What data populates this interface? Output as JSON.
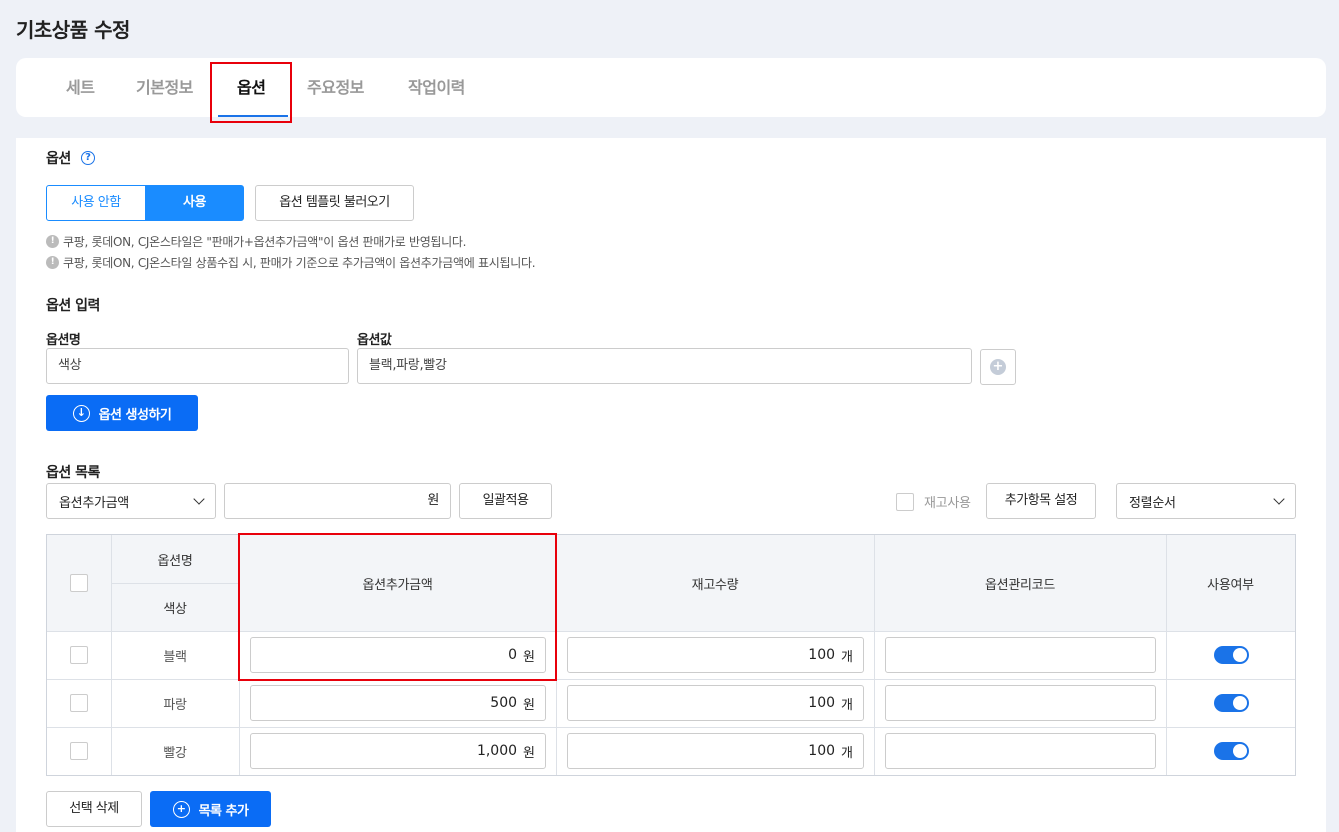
{
  "page_title": "기초상품 수정",
  "tabs": [
    {
      "label": "세트"
    },
    {
      "label": "기본정보"
    },
    {
      "label": "옵션",
      "active": true
    },
    {
      "label": "주요정보"
    },
    {
      "label": "작업이력"
    }
  ],
  "option": {
    "section_label": "옵션",
    "help_icon": "?",
    "toggle_off_label": "사용 안함",
    "toggle_on_label": "사용",
    "selected": "사용",
    "template_button": "옵션 템플릿 불러오기",
    "notices": [
      "쿠팡, 롯데ON, CJ온스타일은 \"판매가+옵션추가금액\"이 옵션 판매가로 반영됩니다.",
      "쿠팡, 롯데ON, CJ온스타일 상품수집 시, 판매가 기준으로 추가금액이 옵션추가금액에 표시됩니다."
    ]
  },
  "option_input": {
    "section_label": "옵션 입력",
    "name_label": "옵션명",
    "name_value": "색상",
    "values_label": "옵션값",
    "values_value": "블랙,파랑,빨강",
    "generate_button": "옵션 생성하기"
  },
  "option_list": {
    "section_label": "옵션 목록",
    "bulk_field_select": "옵션추가금액",
    "bulk_value": "",
    "bulk_unit": "원",
    "bulk_apply_button": "일괄적용",
    "stock_use_label": "재고사용",
    "stock_use_checked": false,
    "extra_settings_button": "추가항목 설정",
    "sort_select": "정렬순서"
  },
  "table": {
    "headers": {
      "option_name": "옵션명",
      "option_name_sub": "색상",
      "extra_price": "옵션추가금액",
      "stock": "재고수량",
      "manage_code": "옵션관리코드",
      "enabled": "사용여부"
    },
    "price_unit": "원",
    "stock_unit": "개",
    "rows": [
      {
        "name": "블랙",
        "extra_price": "0",
        "stock": "100",
        "code": "",
        "enabled": true,
        "checked": false
      },
      {
        "name": "파랑",
        "extra_price": "500",
        "stock": "100",
        "code": "",
        "enabled": true,
        "checked": false
      },
      {
        "name": "빨강",
        "extra_price": "1,000",
        "stock": "100",
        "code": "",
        "enabled": true,
        "checked": false
      }
    ]
  },
  "bottom": {
    "delete_button": "선택 삭제",
    "add_button": "목록 추가"
  },
  "colors": {
    "accent": "#1a73e8",
    "button_blue": "#0a6cf5",
    "highlight": "#e8000b",
    "background": "#eef1f7"
  }
}
